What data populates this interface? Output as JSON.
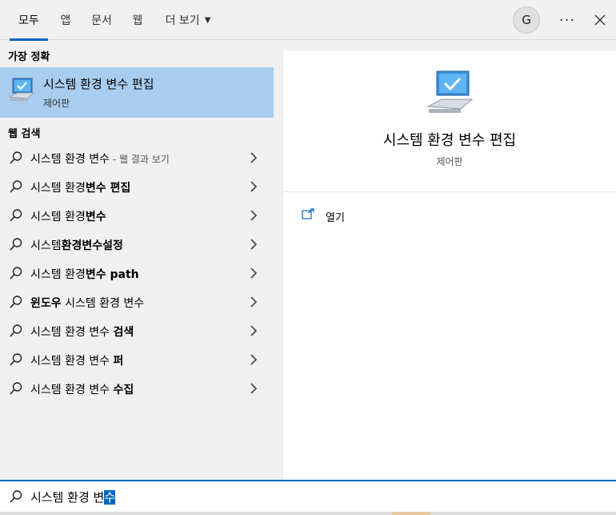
{
  "tabs": [
    {
      "label": "모두",
      "active": true
    },
    {
      "label": "앱"
    },
    {
      "label": "문서"
    },
    {
      "label": "웹"
    },
    {
      "label": "더 보기"
    }
  ],
  "avatar_letter": "G",
  "more_label": "···",
  "best_match": {
    "heading": "가장 정확",
    "title": "시스템 환경 변수 편집",
    "subtitle": "제어판",
    "icon": "computer-monitor-icon"
  },
  "web_search": {
    "heading": "웹 검색",
    "items": [
      {
        "normal": "시스템 환경 변수",
        "bold": "",
        "hint": " - 웹 결과 보기",
        "prefix_bold": ""
      },
      {
        "normal": "시스템 환경",
        "bold": "변수 편집",
        "hint": "",
        "prefix_bold": ""
      },
      {
        "normal": "시스템 환경",
        "bold": "변수",
        "hint": "",
        "prefix_bold": ""
      },
      {
        "normal": "시스템",
        "bold": "환경변수설정",
        "hint": "",
        "prefix_bold": ""
      },
      {
        "normal": "시스템 환경",
        "bold": "변수 path",
        "hint": "",
        "prefix_bold": ""
      },
      {
        "normal": " 시스템 환경 변수",
        "bold": "",
        "hint": "",
        "prefix_bold": "윈도우"
      },
      {
        "normal": "시스템 환경 변수 ",
        "bold": "검색",
        "hint": "",
        "prefix_bold": ""
      },
      {
        "normal": "시스템 환경 변수 ",
        "bold": "퍼",
        "hint": "",
        "prefix_bold": ""
      },
      {
        "normal": "시스템 환경 변수 ",
        "bold": "수집",
        "hint": "",
        "prefix_bold": ""
      }
    ]
  },
  "detail": {
    "title": "시스템 환경 변수 편집",
    "subtitle": "제어판",
    "open_label": "열기"
  },
  "search": {
    "query_before_selection": "시스템 환경 변",
    "query_selected": "수"
  },
  "colors": {
    "accent": "#0067c0",
    "selected_row": "#a9cdee",
    "background": "#f0f0f0"
  }
}
